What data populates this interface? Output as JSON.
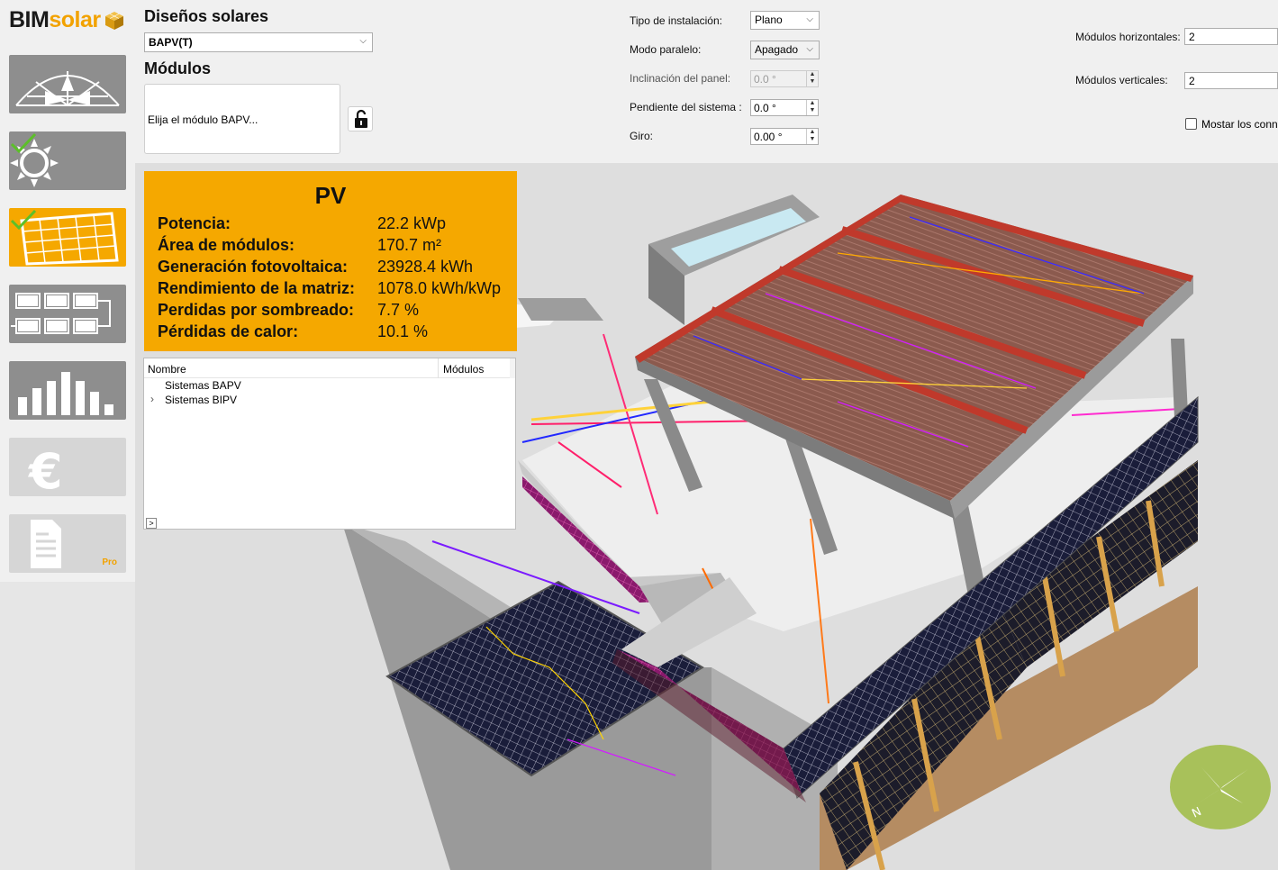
{
  "logo": {
    "part1": "BIM",
    "part2": "solar"
  },
  "sidebar": {
    "items": [
      {
        "name": "site",
        "active": false,
        "checked": false
      },
      {
        "name": "irradiation",
        "active": false,
        "checked": true
      },
      {
        "name": "pv-modules",
        "active": true,
        "checked": true
      },
      {
        "name": "wiring",
        "active": false,
        "checked": false
      },
      {
        "name": "results",
        "active": false,
        "checked": false
      },
      {
        "name": "economics",
        "active": false,
        "checked": false,
        "disabled": true
      },
      {
        "name": "report",
        "active": false,
        "checked": false,
        "disabled": true,
        "badge": "Pro"
      }
    ],
    "accent_color": "#f5a800",
    "check_color": "#5cbf2a"
  },
  "designs": {
    "title": "Diseños solares",
    "selected": "BAPV(T)"
  },
  "modules": {
    "title": "Módulos",
    "placeholder": "Elija el módulo BAPV..."
  },
  "settings": {
    "install_type": {
      "label": "Tipo de instalación:",
      "value": "Plano"
    },
    "parallel_mode": {
      "label": "Modo paralelo:",
      "value": "Apagado"
    },
    "panel_tilt": {
      "label": "Inclinación del panel:",
      "value": "0.0 °"
    },
    "system_slope": {
      "label": "Pendiente del sistema :",
      "value": "0.0 °"
    },
    "rotation": {
      "label": "Giro:",
      "value": "0.00 °"
    },
    "horizontal_modules": {
      "label": "Módulos horizontales:",
      "value": "2"
    },
    "vertical_modules": {
      "label": "Módulos verticales:",
      "value": "2"
    },
    "show_connections": {
      "label": "Mostar los conn",
      "checked": false
    }
  },
  "pv": {
    "title": "PV",
    "rows": [
      {
        "key": "Potencia:",
        "value": "22.2 kWp"
      },
      {
        "key": "Área de módulos:",
        "value": "170.7 m²"
      },
      {
        "key": "Generación fotovoltaica:",
        "value": "23928.4 kWh"
      },
      {
        "key": "Rendimiento de la matriz:",
        "value": "1078.0 kWh/kWp"
      },
      {
        "key": "Perdidas por sombreado:",
        "value": "7.7 %"
      },
      {
        "key": "Pérdidas de calor:",
        "value": "10.1 %"
      }
    ]
  },
  "tree": {
    "col_name": "Nombre",
    "col_modules": "Módulos",
    "items": [
      "Sistemas BAPV",
      "Sistemas BIPV"
    ],
    "expand_glyph": ">",
    "caret_glyph": "›"
  },
  "compass": {
    "north_label": "N",
    "color": "#a8c15a"
  }
}
